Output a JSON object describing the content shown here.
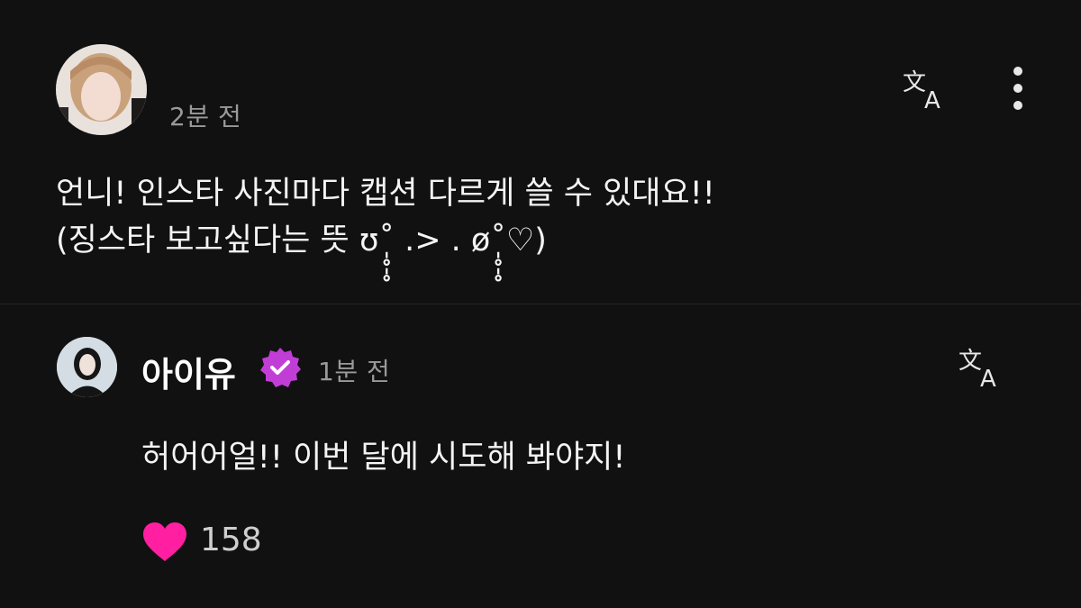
{
  "comment": {
    "time": "2분 전",
    "lines": [
      "언니! 인스타 사진마다 캡션 다르게 쓸 수 있대요!!",
      "(징스타 보고싶다는 뜻 ʊ˚̩̥̩̥ .> . ø˚̩̥̩̥♡)"
    ],
    "icons": {
      "translate": "translate-icon",
      "more": "more-vertical-icon",
      "avatar": "user-avatar"
    }
  },
  "reply": {
    "username": "아이유",
    "time": "1분 전",
    "text": "허어어얼!! 이번 달에 시도해 봐야지!",
    "likes": "158",
    "colors": {
      "verified": "#c13ed6",
      "heart": "#ff1fa0"
    },
    "icons": {
      "translate": "translate-icon",
      "verified": "verified-badge-icon",
      "heart": "heart-icon"
    }
  }
}
